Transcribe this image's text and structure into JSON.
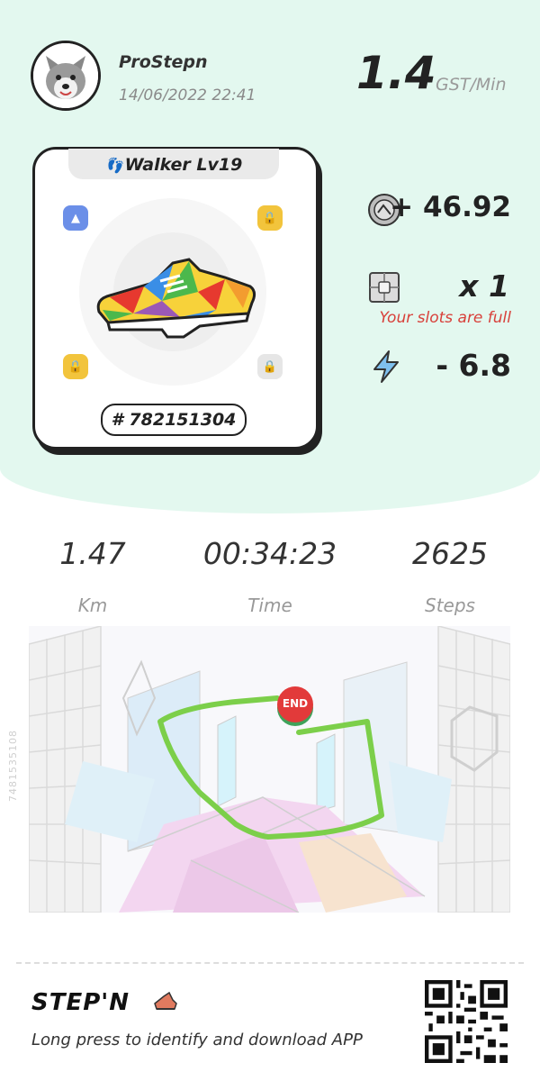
{
  "header": {
    "username": "ProStepn",
    "datetime": "14/06/2022 22:41",
    "rate_value": "1.4",
    "rate_unit": "GST/Min",
    "avatar_icon": "fox-avatar-icon"
  },
  "sneaker": {
    "title": "Walker Lv19",
    "id": "# 782151304",
    "gem_slots": [
      "triangle-gem",
      "lock",
      "lock",
      "lock"
    ]
  },
  "stats": {
    "gst_earned": "+ 46.92",
    "box_count": "x 1",
    "slots_full": "Your slots are full",
    "energy_used": "- 6.8",
    "colors": {
      "warning": "#d8403a",
      "background": "#e3f8ef"
    }
  },
  "metrics": [
    {
      "value": "1.47",
      "label": "Km"
    },
    {
      "value": "00:34:23",
      "label": "Time"
    },
    {
      "value": "2625",
      "label": "Steps"
    }
  ],
  "map": {
    "end_label": "END",
    "watermark": "7481535108",
    "route_color": "#7ccf4a"
  },
  "footer": {
    "logo": "STEP'N",
    "download_text": "Long press to identify and download APP"
  }
}
